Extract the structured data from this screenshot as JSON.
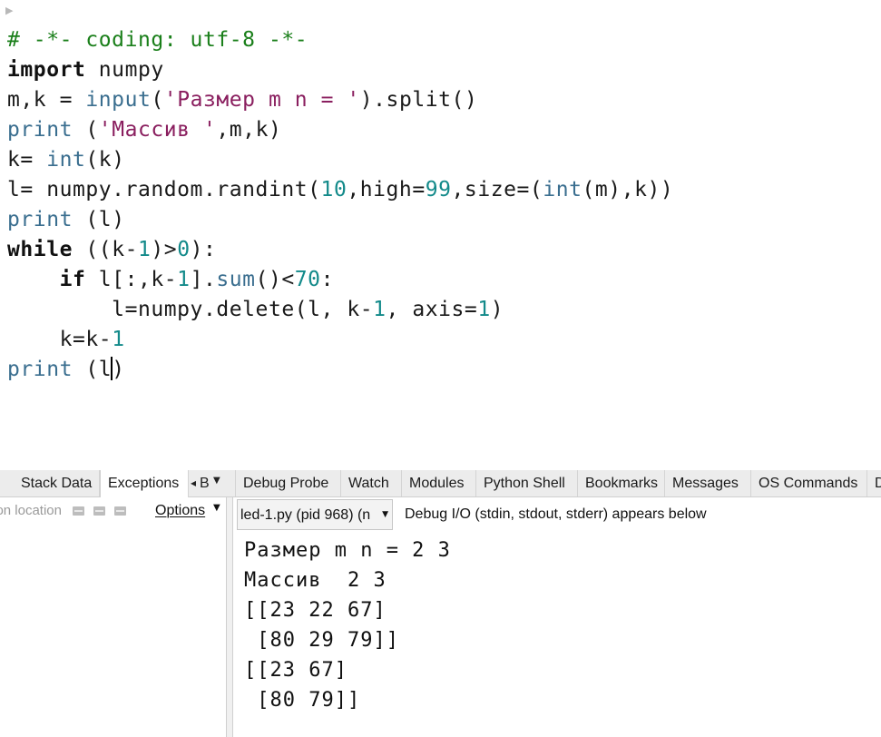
{
  "editor": {
    "fold_marker": "▶",
    "lines": [
      [
        {
          "t": "# -*- coding: utf-8 -*-",
          "c": "com"
        }
      ],
      [
        {
          "t": "import",
          "c": "kw"
        },
        {
          "t": " numpy"
        }
      ],
      [
        {
          "t": "m,k = "
        },
        {
          "t": "input",
          "c": "fn"
        },
        {
          "t": "("
        },
        {
          "t": "'Размер m n = '",
          "c": "str"
        },
        {
          "t": ").split()"
        }
      ],
      [
        {
          "t": "print",
          "c": "fn"
        },
        {
          "t": " ("
        },
        {
          "t": "'Массив '",
          "c": "str"
        },
        {
          "t": ",m,k)"
        }
      ],
      [
        {
          "t": "k= "
        },
        {
          "t": "int",
          "c": "fn"
        },
        {
          "t": "(k)"
        }
      ],
      [
        {
          "t": "l= numpy.random.randint("
        },
        {
          "t": "10",
          "c": "num"
        },
        {
          "t": ",high="
        },
        {
          "t": "99",
          "c": "num"
        },
        {
          "t": ",size=("
        },
        {
          "t": "int",
          "c": "fn"
        },
        {
          "t": "(m),k))"
        }
      ],
      [
        {
          "t": "print",
          "c": "fn"
        },
        {
          "t": " (l)"
        }
      ],
      [
        {
          "t": "while",
          "c": "kw"
        },
        {
          "t": " ((k-"
        },
        {
          "t": "1",
          "c": "num"
        },
        {
          "t": ")>"
        },
        {
          "t": "0",
          "c": "num"
        },
        {
          "t": "):"
        }
      ],
      [
        {
          "t": "    "
        },
        {
          "t": "if",
          "c": "kw"
        },
        {
          "t": " l[:,k-"
        },
        {
          "t": "1",
          "c": "num"
        },
        {
          "t": "]."
        },
        {
          "t": "sum",
          "c": "fn"
        },
        {
          "t": "()<"
        },
        {
          "t": "70",
          "c": "num"
        },
        {
          "t": ":"
        }
      ],
      [
        {
          "t": "        l=numpy.delete(l, k-"
        },
        {
          "t": "1",
          "c": "num"
        },
        {
          "t": ", axis="
        },
        {
          "t": "1",
          "c": "num"
        },
        {
          "t": ")"
        }
      ],
      [
        {
          "t": "    k=k-"
        },
        {
          "t": "1",
          "c": "num"
        }
      ],
      [
        {
          "t": "print",
          "c": "fn"
        },
        {
          "t": " (l"
        },
        {
          "cursor": true
        },
        {
          "t": ")"
        }
      ]
    ]
  },
  "left_tabs": [
    {
      "label": "Stack Data",
      "active": false
    },
    {
      "label": "Exceptions",
      "active": true
    }
  ],
  "left_scroll_label": "B",
  "right_tabs": [
    {
      "label": "Debug Probe"
    },
    {
      "label": "Watch"
    },
    {
      "label": "Modules"
    },
    {
      "label": "Python Shell"
    },
    {
      "label": "Bookmarks"
    },
    {
      "label": "Messages"
    },
    {
      "label": "OS Commands"
    },
    {
      "label": "D"
    }
  ],
  "exceptions_panel": {
    "ignore_label": "Ignore this exception location",
    "options_label": "Options",
    "dropdown_arrow": "▼"
  },
  "debug_io": {
    "process_select": "led-1.py (pid 968) (n",
    "note": "Debug I/O (stdin, stdout, stderr) appears below",
    "output": [
      "Размер m n = 2 3",
      "Массив  2 3",
      "[[23 22 67]",
      " [80 29 79]]",
      "[[23 67]",
      " [80 79]]"
    ]
  }
}
